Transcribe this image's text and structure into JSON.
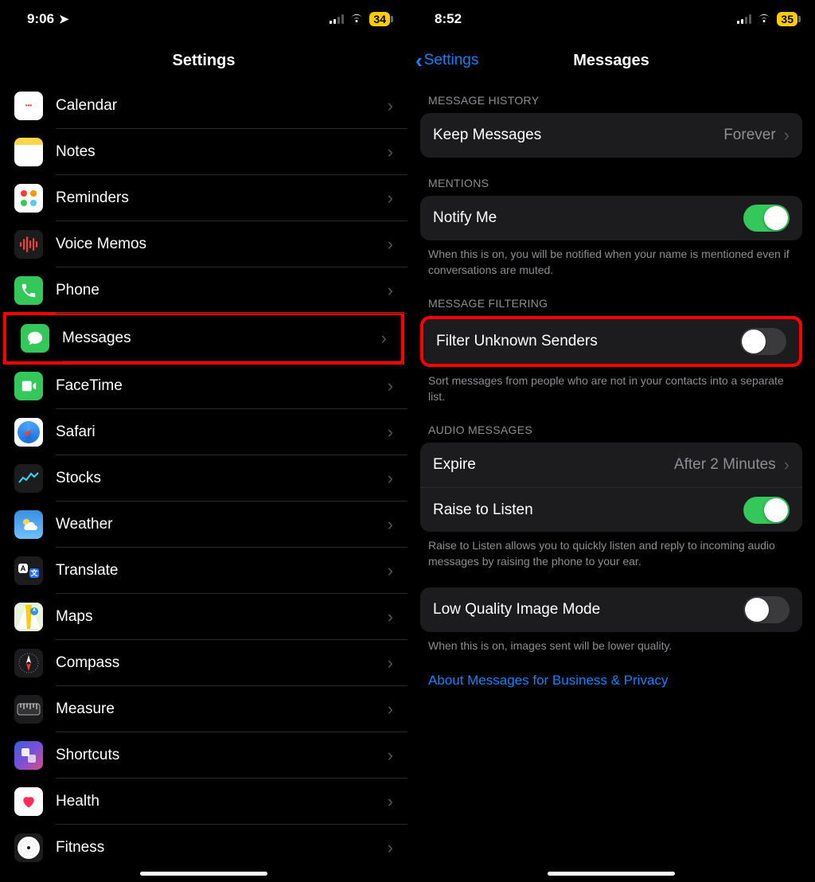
{
  "left": {
    "status": {
      "time": "9:06",
      "battery": "34"
    },
    "nav": {
      "title": "Settings"
    },
    "items": [
      {
        "key": "calendar",
        "label": "Calendar"
      },
      {
        "key": "notes",
        "label": "Notes"
      },
      {
        "key": "reminders",
        "label": "Reminders"
      },
      {
        "key": "voice",
        "label": "Voice Memos"
      },
      {
        "key": "phone",
        "label": "Phone"
      },
      {
        "key": "messages",
        "label": "Messages",
        "highlighted": true
      },
      {
        "key": "facetime",
        "label": "FaceTime"
      },
      {
        "key": "safari",
        "label": "Safari"
      },
      {
        "key": "stocks",
        "label": "Stocks"
      },
      {
        "key": "weather",
        "label": "Weather"
      },
      {
        "key": "translate",
        "label": "Translate"
      },
      {
        "key": "maps",
        "label": "Maps"
      },
      {
        "key": "compass",
        "label": "Compass"
      },
      {
        "key": "measure",
        "label": "Measure"
      },
      {
        "key": "shortcuts",
        "label": "Shortcuts"
      },
      {
        "key": "health",
        "label": "Health"
      },
      {
        "key": "fitness",
        "label": "Fitness"
      }
    ]
  },
  "right": {
    "status": {
      "time": "8:52",
      "battery": "35"
    },
    "nav": {
      "back": "Settings",
      "title": "Messages"
    },
    "sections": {
      "history": {
        "header": "MESSAGE HISTORY",
        "keep": {
          "label": "Keep Messages",
          "value": "Forever"
        }
      },
      "mentions": {
        "header": "MENTIONS",
        "notify": {
          "label": "Notify Me",
          "on": true
        },
        "footer": "When this is on, you will be notified when your name is mentioned even if conversations are muted."
      },
      "filtering": {
        "header": "MESSAGE FILTERING",
        "filter": {
          "label": "Filter Unknown Senders",
          "on": false,
          "highlighted": true
        },
        "footer": "Sort messages from people who are not in your contacts into a separate list."
      },
      "audio": {
        "header": "AUDIO MESSAGES",
        "expire": {
          "label": "Expire",
          "value": "After 2 Minutes"
        },
        "raise": {
          "label": "Raise to Listen",
          "on": true
        },
        "footer": "Raise to Listen allows you to quickly listen and reply to incoming audio messages by raising the phone to your ear."
      },
      "lowq": {
        "cell": {
          "label": "Low Quality Image Mode",
          "on": false
        },
        "footer": "When this is on, images sent will be lower quality."
      },
      "link": "About Messages for Business & Privacy"
    }
  }
}
